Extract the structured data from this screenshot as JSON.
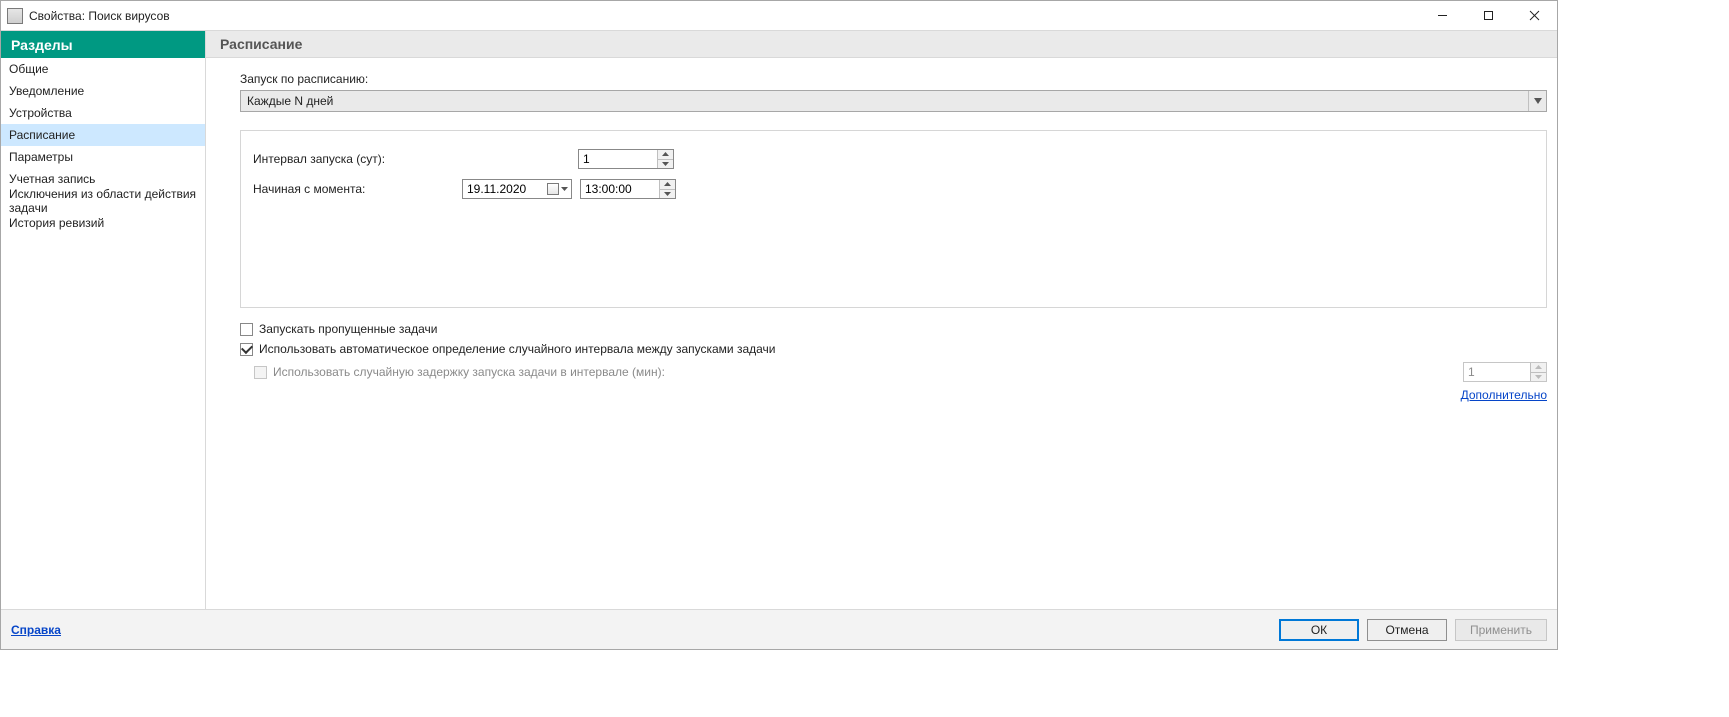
{
  "titlebar": {
    "title": "Свойства: Поиск вирусов"
  },
  "sidebar": {
    "header": "Разделы",
    "items": [
      {
        "label": "Общие"
      },
      {
        "label": "Уведомление"
      },
      {
        "label": "Устройства"
      },
      {
        "label": "Расписание"
      },
      {
        "label": "Параметры"
      },
      {
        "label": "Учетная запись"
      },
      {
        "label": "Исключения из области действия задачи"
      },
      {
        "label": "История ревизий"
      }
    ],
    "selected_index": 3
  },
  "main": {
    "heading": "Расписание",
    "schedule_label": "Запуск по расписанию:",
    "schedule_value": "Каждые N дней",
    "interval_label": "Интервал запуска (сут):",
    "interval_value": "1",
    "start_label": "Начиная с момента:",
    "start_date": "19.11.2020",
    "start_time": "13:00:00",
    "run_missed_label": "Запускать пропущенные задачи",
    "run_missed_checked": false,
    "auto_random_label": "Использовать автоматическое определение случайного интервала между запусками задачи",
    "auto_random_checked": true,
    "random_delay_label": "Использовать случайную задержку запуска задачи в интервале (мин):",
    "random_delay_value": "1",
    "advanced_link": "Дополнительно"
  },
  "footer": {
    "help": "Справка",
    "ok": "ОК",
    "cancel": "Отмена",
    "apply": "Применить"
  }
}
